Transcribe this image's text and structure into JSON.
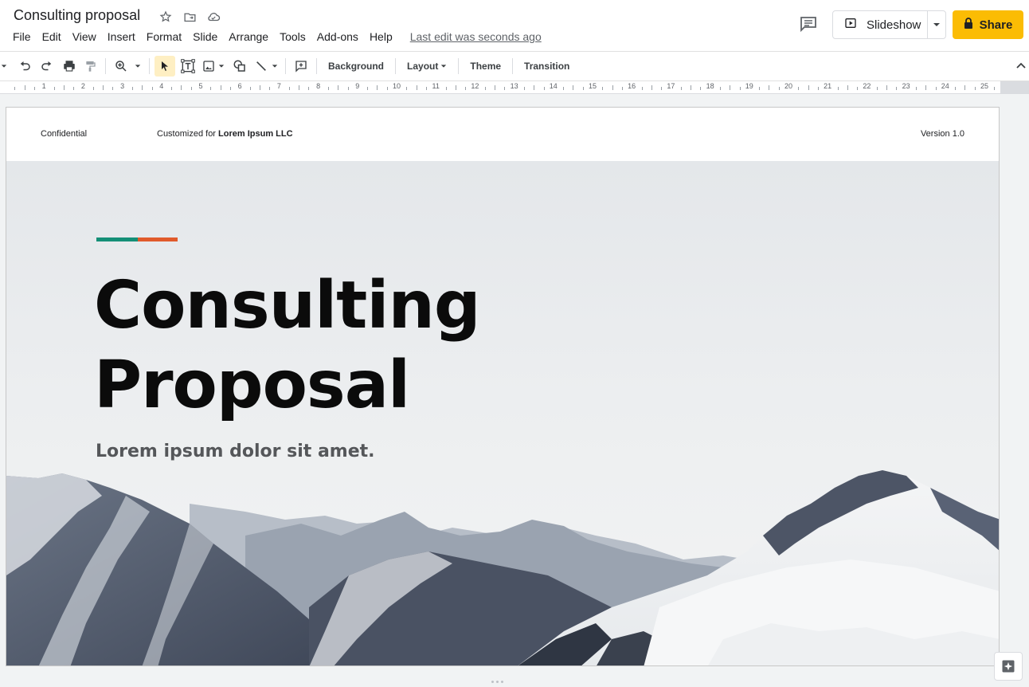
{
  "app": {
    "doc_title": "Consulting proposal",
    "menus": [
      "File",
      "Edit",
      "View",
      "Insert",
      "Format",
      "Slide",
      "Arrange",
      "Tools",
      "Add-ons",
      "Help"
    ],
    "last_edit": "Last edit was seconds ago",
    "slideshow_label": "Slideshow",
    "share_label": "Share",
    "accent_color": "#fbbc04"
  },
  "toolbar": {
    "background_label": "Background",
    "layout_label": "Layout",
    "theme_label": "Theme",
    "transition_label": "Transition"
  },
  "ruler": {
    "numbers": [
      "1",
      "2",
      "3",
      "4",
      "5",
      "6",
      "7",
      "8",
      "9",
      "10",
      "11",
      "12",
      "13",
      "14",
      "15",
      "16",
      "17",
      "18",
      "19",
      "20",
      "21",
      "22",
      "23",
      "24",
      "25"
    ]
  },
  "slide": {
    "header_left": "Confidential",
    "customized_prefix": "Customized for ",
    "customized_company": "Lorem Ipsum LLC",
    "header_right": "Version 1.0",
    "title_line1": "Consulting",
    "title_line2": "Proposal",
    "subtitle": "Lorem ipsum dolor sit amet.",
    "accent_colors": [
      "#148f77",
      "#e05a2b"
    ]
  }
}
